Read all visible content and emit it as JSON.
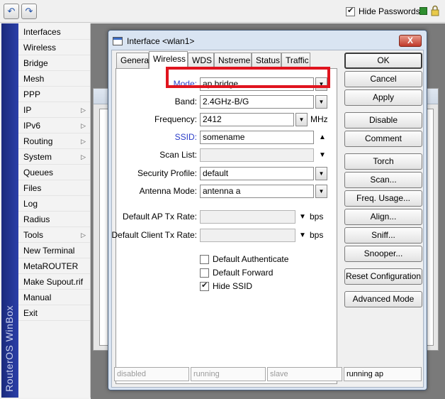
{
  "toolbar": {
    "undo_icon": "undo-icon",
    "redo_icon": "redo-icon",
    "hide_passwords_label": "Hide Passwords",
    "hide_passwords_checked": true
  },
  "brand": {
    "text": "RouterOS WinBox",
    "color": "#2b3fa8"
  },
  "menu": {
    "items": [
      {
        "label": "Interfaces",
        "submenu": false
      },
      {
        "label": "Wireless",
        "submenu": false
      },
      {
        "label": "Bridge",
        "submenu": false
      },
      {
        "label": "Mesh",
        "submenu": false
      },
      {
        "label": "PPP",
        "submenu": false
      },
      {
        "label": "IP",
        "submenu": true
      },
      {
        "label": "IPv6",
        "submenu": true
      },
      {
        "label": "Routing",
        "submenu": true
      },
      {
        "label": "System",
        "submenu": true
      },
      {
        "label": "Queues",
        "submenu": false
      },
      {
        "label": "Files",
        "submenu": false
      },
      {
        "label": "Log",
        "submenu": false
      },
      {
        "label": "Radius",
        "submenu": false
      },
      {
        "label": "Tools",
        "submenu": true
      },
      {
        "label": "New Terminal",
        "submenu": false
      },
      {
        "label": "MetaROUTER",
        "submenu": false
      },
      {
        "label": "Make Supout.rif",
        "submenu": false
      },
      {
        "label": "Manual",
        "submenu": false
      },
      {
        "label": "Exit",
        "submenu": false
      }
    ]
  },
  "dialog": {
    "title": "Interface <wlan1>",
    "close_label": "X",
    "tabs": [
      {
        "label": "General",
        "active": false
      },
      {
        "label": "Wireless",
        "active": true
      },
      {
        "label": "WDS",
        "active": false
      },
      {
        "label": "Nstreme",
        "active": false
      },
      {
        "label": "Status",
        "active": false
      },
      {
        "label": "Traffic",
        "active": false
      }
    ],
    "fields": {
      "mode_label": "Mode:",
      "mode_value": "ap bridge",
      "band_label": "Band:",
      "band_value": "2.4GHz-B/G",
      "frequency_label": "Frequency:",
      "frequency_value": "2412",
      "frequency_unit": "MHz",
      "ssid_label": "SSID:",
      "ssid_value": "somename",
      "scan_list_label": "Scan List:",
      "scan_list_value": "",
      "security_profile_label": "Security Profile:",
      "security_profile_value": "default",
      "antenna_mode_label": "Antenna Mode:",
      "antenna_mode_value": "antenna a",
      "default_ap_tx_label": "Default AP Tx Rate:",
      "default_ap_tx_value": "",
      "default_client_tx_label": "Default Client Tx Rate:",
      "default_client_tx_value": "",
      "rate_unit": "bps"
    },
    "checkboxes": [
      {
        "label": "Default Authenticate",
        "checked": false
      },
      {
        "label": "Default Forward",
        "checked": false
      },
      {
        "label": "Hide SSID",
        "checked": true
      }
    ],
    "buttons": {
      "ok": "OK",
      "cancel": "Cancel",
      "apply": "Apply",
      "disable": "Disable",
      "comment": "Comment",
      "torch": "Torch",
      "scan": "Scan...",
      "freq_usage": "Freq. Usage...",
      "align": "Align...",
      "sniff": "Sniff...",
      "snooper": "Snooper...",
      "reset_configuration": "Reset Configuration",
      "advanced_mode": "Advanced Mode"
    },
    "status_bar": [
      "disabled",
      "running",
      "slave",
      "running ap"
    ]
  },
  "highlight_color": "#e0141e"
}
